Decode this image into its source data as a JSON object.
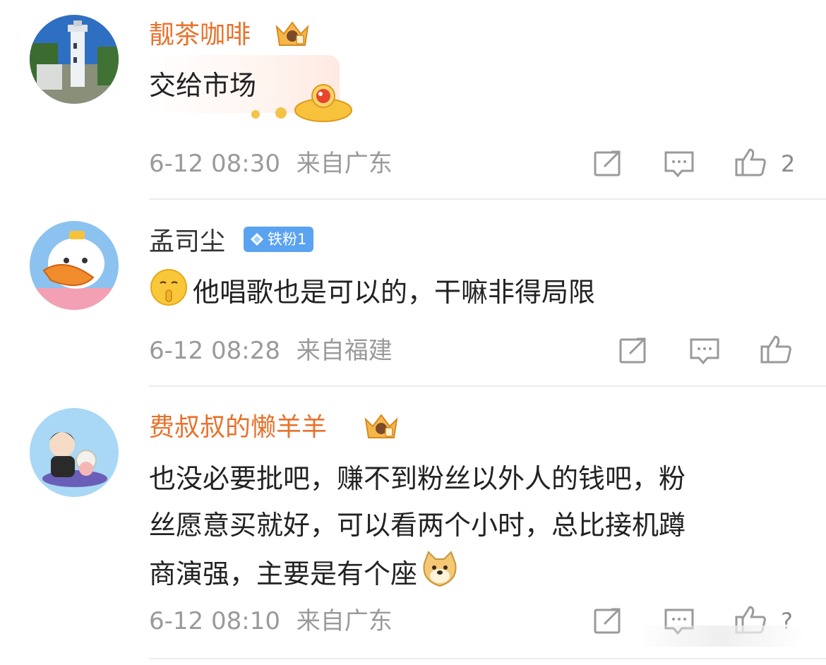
{
  "comments": [
    {
      "username": "靓茶咖啡",
      "user_level": "vip-crown",
      "text": "交给市场",
      "time": "6-12 08:30",
      "location": "来自广东",
      "likes": "2"
    },
    {
      "username": "孟司尘",
      "badge": "铁粉1",
      "text": "他唱歌也是可以的，干嘛非得局限",
      "time": "6-12 08:28",
      "location": "来自福建",
      "likes": ""
    },
    {
      "username": "费叔叔的懒羊羊",
      "user_level": "vip-crown",
      "text_lines": [
        "也没必要批吧，赚不到粉丝以外人的钱吧，粉",
        "丝愿意买就好，可以看两个小时，总比接机蹲",
        "商演强，主要是有个座"
      ],
      "time": "6-12 08:10",
      "location": "来自广东",
      "likes": "?"
    }
  ],
  "colors": {
    "vip_name": "#e8722c",
    "normal_name": "#333333",
    "meta": "#9a9a9a",
    "badge_bg": "#5aa3f0",
    "divider": "#ececec"
  },
  "icons": {
    "share": "share-square-arrow-icon",
    "reply": "comment-bubble-icon",
    "like": "thumbs-up-icon",
    "crown": "vip-crown-icon",
    "diamond": "diamond-icon"
  }
}
